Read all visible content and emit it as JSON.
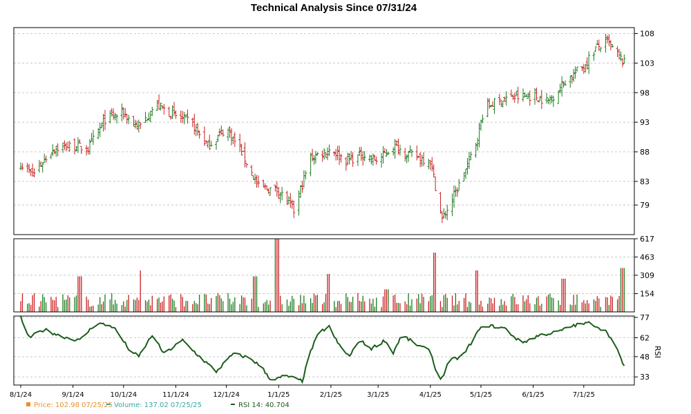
{
  "chart_data": {
    "title": "Technical Analysis Since 07/31/24",
    "type": "candlestick",
    "x_labels": [
      "8/1/24",
      "9/1/24",
      "10/1/24",
      "11/1/24",
      "12/1/24",
      "1/1/25",
      "2/1/25",
      "3/1/25",
      "4/1/25",
      "5/1/25",
      "6/1/25",
      "7/1/25"
    ],
    "price_panel": {
      "yticks": [
        79,
        83,
        88,
        93,
        98,
        103,
        108
      ],
      "ylim": [
        74,
        109
      ],
      "up_color": "#1a7a1a",
      "down_color": "#c81e1e",
      "anchors": [
        [
          "2024-08-01",
          86.0
        ],
        [
          "2024-08-08",
          84.0
        ],
        [
          "2024-08-20",
          88.5
        ],
        [
          "2024-09-01",
          89.0
        ],
        [
          "2024-09-10",
          88.5
        ],
        [
          "2024-09-20",
          93.5
        ],
        [
          "2024-10-01",
          94.5
        ],
        [
          "2024-10-10",
          92.0
        ],
        [
          "2024-10-20",
          96.0
        ],
        [
          "2024-11-01",
          94.0
        ],
        [
          "2024-11-10",
          93.0
        ],
        [
          "2024-11-20",
          89.0
        ],
        [
          "2024-12-01",
          92.0
        ],
        [
          "2024-12-10",
          88.0
        ],
        [
          "2024-12-20",
          82.0
        ],
        [
          "2025-01-01",
          81.5
        ],
        [
          "2025-01-10",
          78.0
        ],
        [
          "2025-01-20",
          87.0
        ],
        [
          "2025-02-01",
          88.5
        ],
        [
          "2025-02-10",
          86.5
        ],
        [
          "2025-02-20",
          87.5
        ],
        [
          "2025-03-01",
          86.5
        ],
        [
          "2025-03-10",
          89.0
        ],
        [
          "2025-03-20",
          87.5
        ],
        [
          "2025-04-01",
          86.5
        ],
        [
          "2025-04-08",
          76.5
        ],
        [
          "2025-04-20",
          83.5
        ],
        [
          "2025-04-28",
          89.5
        ],
        [
          "2025-05-03",
          95.5
        ],
        [
          "2025-05-15",
          97.0
        ],
        [
          "2025-06-01",
          97.5
        ],
        [
          "2025-06-10",
          96.5
        ],
        [
          "2025-06-20",
          100.0
        ],
        [
          "2025-07-01",
          102.5
        ],
        [
          "2025-07-08",
          105.5
        ],
        [
          "2025-07-15",
          106.5
        ],
        [
          "2025-07-25",
          102.98
        ]
      ]
    },
    "volume_panel": {
      "yticks": [
        154,
        309,
        463,
        617
      ],
      "ylim": [
        0,
        617
      ],
      "color": "#3aa3a3",
      "spikes": [
        [
          "2024-09-05",
          300
        ],
        [
          "2024-10-12",
          350
        ],
        [
          "2024-12-18",
          300
        ],
        [
          "2024-12-31",
          617
        ],
        [
          "2025-01-31",
          320
        ],
        [
          "2025-03-06",
          190
        ],
        [
          "2025-04-04",
          500
        ],
        [
          "2025-04-28",
          350
        ],
        [
          "2025-06-19",
          280
        ],
        [
          "2025-07-24",
          370
        ]
      ]
    },
    "rsi_panel": {
      "yticks": [
        33,
        48,
        62,
        77
      ],
      "ylim": [
        27,
        78
      ],
      "axis_label": "RSI",
      "color": "#1a5c1a",
      "anchors": [
        [
          "2024-08-01",
          77
        ],
        [
          "2024-08-06",
          62
        ],
        [
          "2024-08-15",
          68
        ],
        [
          "2024-08-25",
          63
        ],
        [
          "2024-09-05",
          60
        ],
        [
          "2024-09-15",
          73
        ],
        [
          "2024-09-25",
          70
        ],
        [
          "2024-10-05",
          52
        ],
        [
          "2024-10-10",
          48
        ],
        [
          "2024-10-18",
          64
        ],
        [
          "2024-10-25",
          50
        ],
        [
          "2024-11-05",
          60
        ],
        [
          "2024-11-15",
          48
        ],
        [
          "2024-11-25",
          37
        ],
        [
          "2024-12-05",
          50
        ],
        [
          "2024-12-15",
          47
        ],
        [
          "2024-12-22",
          40
        ],
        [
          "2024-12-28",
          30
        ],
        [
          "2025-01-05",
          34
        ],
        [
          "2025-01-15",
          30
        ],
        [
          "2025-01-20",
          52
        ],
        [
          "2025-01-25",
          66
        ],
        [
          "2025-01-31",
          70
        ],
        [
          "2025-02-05",
          58
        ],
        [
          "2025-02-12",
          48
        ],
        [
          "2025-02-18",
          60
        ],
        [
          "2025-02-25",
          54
        ],
        [
          "2025-03-05",
          60
        ],
        [
          "2025-03-10",
          51
        ],
        [
          "2025-03-15",
          64
        ],
        [
          "2025-03-25",
          56
        ],
        [
          "2025-04-01",
          52
        ],
        [
          "2025-04-05",
          34
        ],
        [
          "2025-04-08",
          32
        ],
        [
          "2025-04-12",
          45
        ],
        [
          "2025-04-20",
          48
        ],
        [
          "2025-04-30",
          68
        ],
        [
          "2025-05-05",
          71
        ],
        [
          "2025-05-15",
          69
        ],
        [
          "2025-05-25",
          58
        ],
        [
          "2025-06-05",
          64
        ],
        [
          "2025-06-15",
          66
        ],
        [
          "2025-06-25",
          71
        ],
        [
          "2025-07-05",
          73
        ],
        [
          "2025-07-15",
          66
        ],
        [
          "2025-07-20",
          55
        ],
        [
          "2025-07-25",
          41
        ]
      ]
    },
    "legend": [
      {
        "label": "Price: 102.98  07/25/25",
        "color": "#e8922a",
        "marker": "square"
      },
      {
        "label": "Volume: 137.02  07/25/25",
        "color": "#3aa3a3",
        "marker": "dash"
      },
      {
        "label": "RSI 14: 40.704",
        "color": "#1a5c1a",
        "marker": "dash"
      }
    ]
  }
}
